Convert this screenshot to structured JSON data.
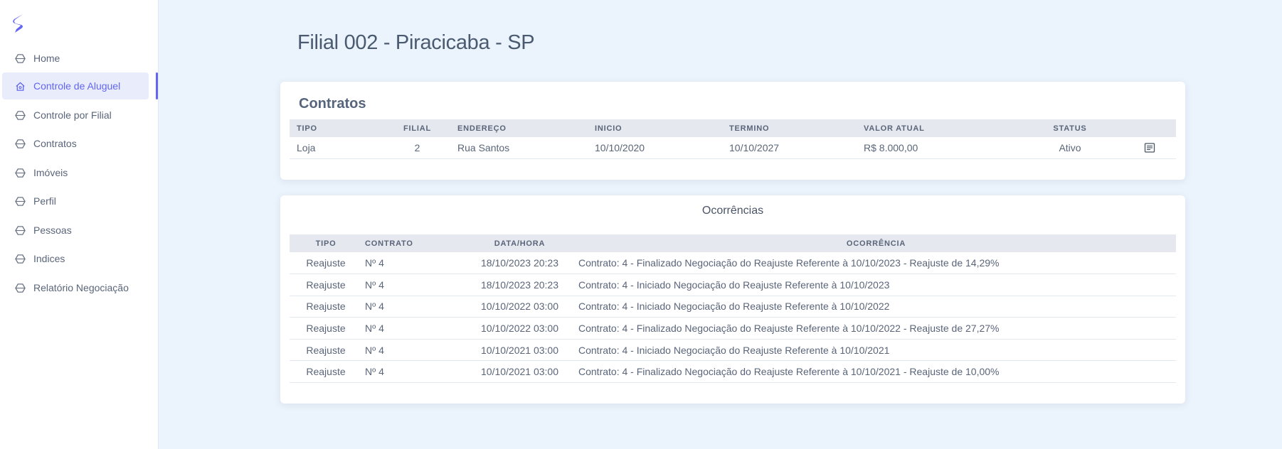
{
  "sidebar": {
    "items": [
      {
        "label": "Home",
        "icon": "hexagon-icon",
        "active": false
      },
      {
        "label": "Controle de Aluguel",
        "icon": "home-icon",
        "active": true
      },
      {
        "label": "Controle por Filial",
        "icon": "hexagon-icon",
        "active": false
      },
      {
        "label": "Contratos",
        "icon": "hexagon-icon",
        "active": false
      },
      {
        "label": "Imóveis",
        "icon": "hexagon-icon",
        "active": false
      },
      {
        "label": "Perfil",
        "icon": "hexagon-icon",
        "active": false
      },
      {
        "label": "Pessoas",
        "icon": "hexagon-icon",
        "active": false
      },
      {
        "label": "Indices",
        "icon": "hexagon-icon",
        "active": false
      },
      {
        "label": "Relatório Negociação",
        "icon": "hexagon-icon",
        "active": false
      }
    ]
  },
  "page": {
    "title": "Filial 002 - Piracicaba - SP"
  },
  "contratos": {
    "title": "Contratos",
    "headers": [
      "TIPO",
      "FILIAL",
      "ENDEREÇO",
      "INICIO",
      "TERMINO",
      "VALOR ATUAL",
      "STATUS",
      ""
    ],
    "rows": [
      {
        "tipo": "Loja",
        "filial": "2",
        "endereco": "Rua Santos",
        "inicio": "10/10/2020",
        "termino": "10/10/2027",
        "valor": "R$ 8.000,00",
        "status": "Ativo",
        "action_icon": "document-icon"
      }
    ]
  },
  "ocorrencias": {
    "title": "Ocorrências",
    "headers": [
      "TIPO",
      "CONTRATO",
      "DATA/HORA",
      "OCORRÊNCIA"
    ],
    "rows": [
      {
        "tipo": "Reajuste",
        "contrato": "Nº 4",
        "data": "18/10/2023 20:23",
        "ocorrencia": "Contrato: 4 - Finalizado Negociação do Reajuste Referente à 10/10/2023 - Reajuste de 14,29%"
      },
      {
        "tipo": "Reajuste",
        "contrato": "Nº 4",
        "data": "18/10/2023 20:23",
        "ocorrencia": "Contrato: 4 - Iniciado Negociação do Reajuste Referente à 10/10/2023"
      },
      {
        "tipo": "Reajuste",
        "contrato": "Nº 4",
        "data": "10/10/2022 03:00",
        "ocorrencia": "Contrato: 4 - Iniciado Negociação do Reajuste Referente à 10/10/2022"
      },
      {
        "tipo": "Reajuste",
        "contrato": "Nº 4",
        "data": "10/10/2022 03:00",
        "ocorrencia": "Contrato: 4 - Finalizado Negociação do Reajuste Referente à 10/10/2022 - Reajuste de 27,27%"
      },
      {
        "tipo": "Reajuste",
        "contrato": "Nº 4",
        "data": "10/10/2021 03:00",
        "ocorrencia": "Contrato: 4 - Iniciado Negociação do Reajuste Referente à 10/10/2021"
      },
      {
        "tipo": "Reajuste",
        "contrato": "Nº 4",
        "data": "10/10/2021 03:00",
        "ocorrencia": "Contrato: 4 - Finalizado Negociação do Reajuste Referente à 10/10/2021 - Reajuste de 10,00%"
      }
    ]
  },
  "colors": {
    "accent": "#6366f1",
    "background": "#ebf3fc",
    "active_bg": "#e8ecfb"
  }
}
